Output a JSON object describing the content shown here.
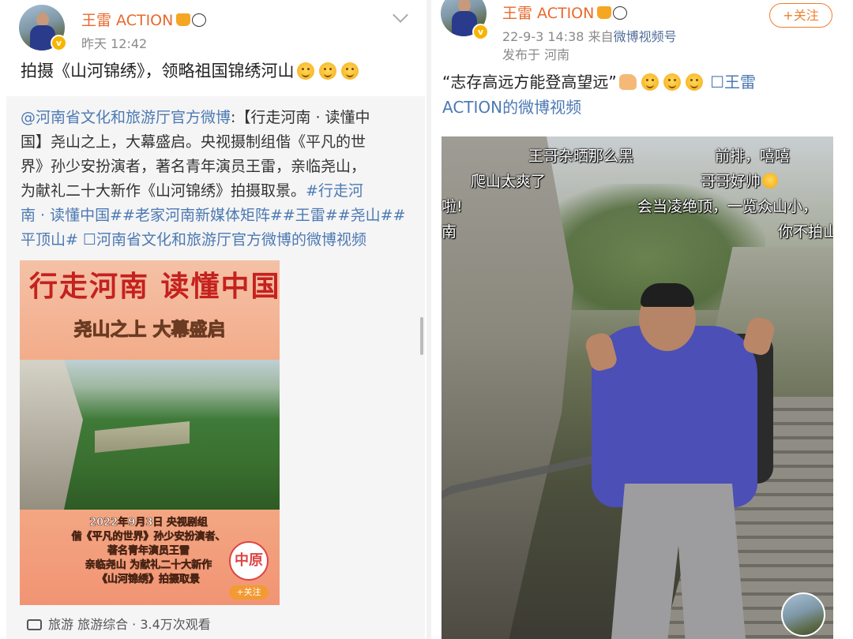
{
  "left_post": {
    "username": "王雷 ACTION",
    "time": "昨天 12:42",
    "text": "拍摄《山河锦绣》，领略祖国锦绣河山",
    "repost": {
      "lines": [
        [
          {
            "t": "@河南省文化和旅游厅官方微博",
            "link": true
          },
          {
            "t": ":【行走河南 · 读懂中",
            "link": false
          }
        ],
        [
          {
            "t": "国】尧山之上，大幕盛启。央视摄制组偕《平凡的世",
            "link": false
          }
        ],
        [
          {
            "t": "界》孙少安扮演者，著名青年演员王雷，亲临尧山，",
            "link": false
          }
        ],
        [
          {
            "t": "为献礼二十大新作《山河锦绣》拍摄取景。",
            "link": false
          },
          {
            "t": "#行走河",
            "link": true
          }
        ],
        [
          {
            "t": "南 · 读懂中国##老家河南新媒体矩阵##王雷##尧山##",
            "link": true
          }
        ],
        [
          {
            "t": "平顶山#",
            "link": true
          },
          {
            "t": " ",
            "link": false
          },
          {
            "t": "☐河南省文化和旅游厅官方微博的微博视频",
            "link": true
          }
        ]
      ],
      "thumbnail": {
        "title_line1": "行走河南 读懂中国",
        "title_line2": "尧山之上 大幕盛启",
        "caption_lines": [
          "2022年9月3日 央视剧组",
          "偕《平凡的世界》孙少安扮演者、",
          "著名青年演员王雷",
          "亲临尧山 为献礼二十大新作",
          "《山河锦绣》拍摄取景"
        ],
        "seal_text": "中原",
        "follow_label": "+关注"
      },
      "footer": "旅游 旅游综合 · 3.4万次观看"
    }
  },
  "right_post": {
    "username": "王雷 ACTION",
    "date": "22-9-3 14:38",
    "source_prefix": "来自",
    "source": "微博视频号",
    "location": "发布于 河南",
    "follow_label": "+关注",
    "text_main": "“志存高远方能登高望远”",
    "video_link_line1": "☐王雷",
    "video_link_line2": "ACTION的微博视频",
    "danmu": [
      {
        "text": "王哥杂晒那么黑"
      },
      {
        "text": "前排，嘻嘻"
      },
      {
        "text": "爬山太爽了"
      },
      {
        "text": "哥哥好帅"
      },
      {
        "text": "啦!"
      },
      {
        "text": "会当凌绝顶，一览众山小，"
      },
      {
        "text": "南"
      },
      {
        "text": "你不拍山"
      }
    ]
  },
  "colors": {
    "username": "#e8692d",
    "link": "#4c79b3",
    "meta": "#8a8a8a",
    "follow_border": "#f07f2f"
  }
}
